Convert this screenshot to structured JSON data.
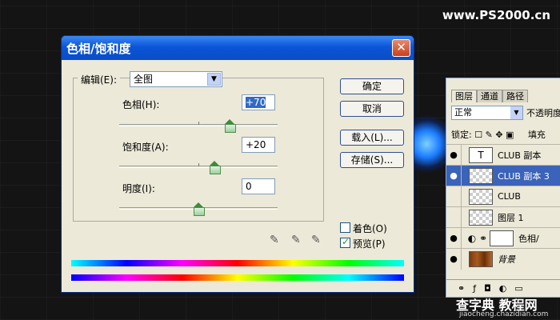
{
  "site_watermark": "www.PS2000.cn",
  "dialog": {
    "title": "色相/饱和度",
    "close": "✕",
    "edit_label": "编辑(E):",
    "edit_value": "全图",
    "hue_label": "色相(H):",
    "hue_value": "+70",
    "saturation_label": "饱和度(A):",
    "saturation_value": "+20",
    "lightness_label": "明度(I):",
    "lightness_value": "0",
    "hue_level": 70,
    "saturation_level": 20,
    "lightness_level": 0,
    "buttons": {
      "ok": "确定",
      "cancel": "取消",
      "load": "载入(L)...",
      "save": "存储(S)..."
    },
    "colorize_label": "着色(O)",
    "colorize_checked": false,
    "preview_label": "预览(P)",
    "preview_checked": true
  },
  "layers_panel": {
    "tabs": [
      "图层",
      "通道",
      "路径"
    ],
    "blend_mode": "正常",
    "opacity_label": "不透明度",
    "lock_label": "锁定:",
    "fill_label": "填充",
    "layers": [
      {
        "name": "CLUB 副本",
        "thumb": "T",
        "visible": true,
        "selected": false
      },
      {
        "name": "CLUB 副本 3",
        "thumb": "",
        "visible": true,
        "selected": true
      },
      {
        "name": "CLUB",
        "thumb": "",
        "visible": false,
        "selected": false
      },
      {
        "name": "图层 1",
        "thumb": "",
        "visible": false,
        "selected": false
      },
      {
        "name": "色相/",
        "thumb": "",
        "visible": true,
        "selected": false
      },
      {
        "name": "背景",
        "thumb": "",
        "visible": true,
        "selected": false
      }
    ]
  },
  "footer_watermark": "查字典 教程网",
  "footer_url": "jiaocheng.chazidian.com"
}
